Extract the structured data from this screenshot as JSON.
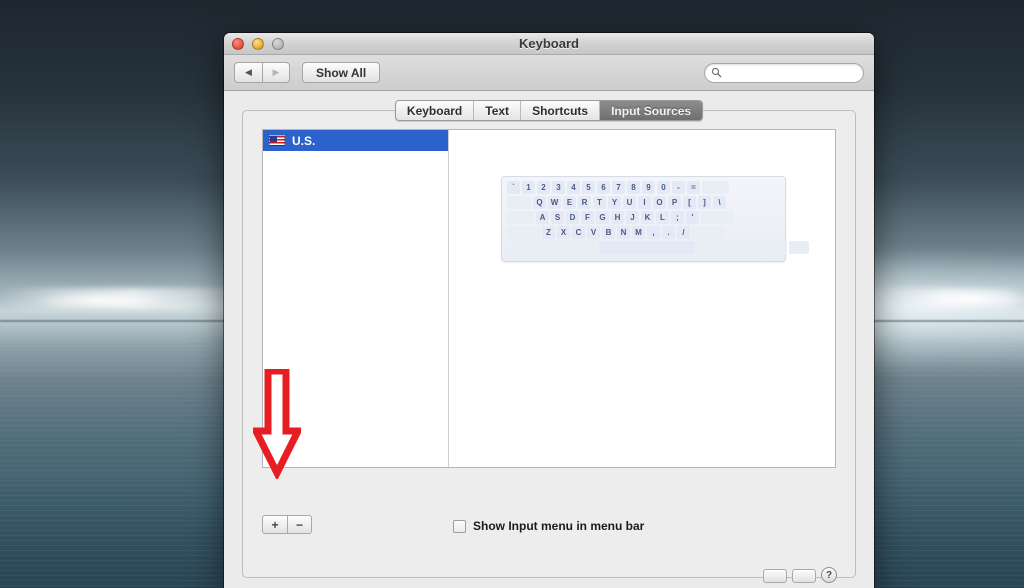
{
  "window": {
    "title": "Keyboard",
    "traffic_lights": [
      "close-red",
      "minimize-yellow",
      "zoom-gray-disabled"
    ]
  },
  "toolbar": {
    "back_label": "◀",
    "forward_label": "▶",
    "show_all_label": "Show All",
    "search_value": "",
    "search_placeholder": "",
    "search_icon": "search-icon"
  },
  "tabs": [
    {
      "label": "Keyboard",
      "active": false
    },
    {
      "label": "Text",
      "active": false
    },
    {
      "label": "Shortcuts",
      "active": false
    },
    {
      "label": "Input Sources",
      "active": true
    }
  ],
  "input_sources": {
    "items": [
      {
        "label": "U.S.",
        "icon": "us-flag-icon",
        "selected": true
      }
    ],
    "add_label": "+",
    "remove_label": "−"
  },
  "checkbox": {
    "label": "Show Input menu in menu bar",
    "checked": false
  },
  "keyboard_preview": {
    "rows": [
      [
        "`",
        "1",
        "2",
        "3",
        "4",
        "5",
        "6",
        "7",
        "8",
        "9",
        "0",
        "-",
        "="
      ],
      [
        "Q",
        "W",
        "E",
        "R",
        "T",
        "Y",
        "U",
        "I",
        "O",
        "P",
        "[",
        "]",
        "\\"
      ],
      [
        "A",
        "S",
        "D",
        "F",
        "G",
        "H",
        "J",
        "K",
        "L",
        ";",
        "'"
      ],
      [
        "Z",
        "X",
        "C",
        "V",
        "B",
        "N",
        "M",
        ",",
        ".",
        "/"
      ]
    ]
  },
  "annotation": {
    "type": "down-arrow",
    "color": "#e81c23",
    "points_at": "add-input-source-button"
  },
  "edge_widgets": {
    "help_label": "?"
  }
}
